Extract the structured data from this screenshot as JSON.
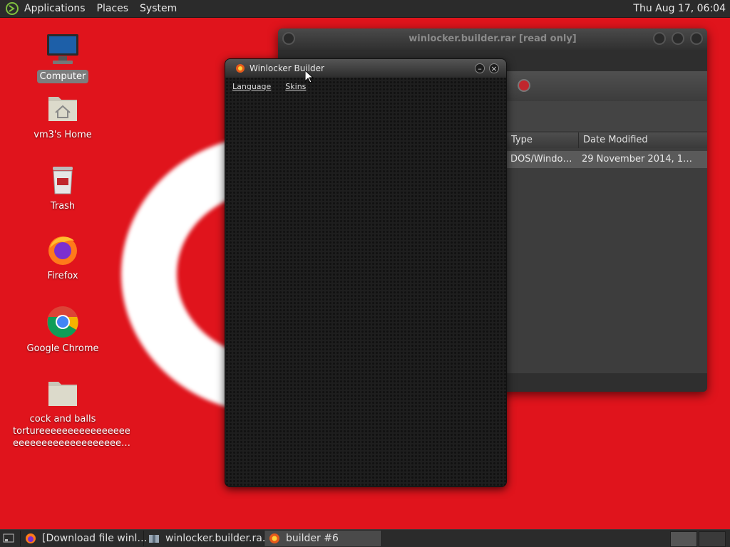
{
  "top_panel": {
    "menus": [
      "Applications",
      "Places",
      "System"
    ],
    "clock": "Thu Aug 17, 06:04"
  },
  "desktop": {
    "icons": [
      {
        "label": "Computer",
        "icon": "computer-icon"
      },
      {
        "label": "vm3's Home",
        "icon": "home-folder-icon"
      },
      {
        "label": "Trash",
        "icon": "trash-icon"
      },
      {
        "label": "Firefox",
        "icon": "firefox-icon"
      },
      {
        "label": "Google Chrome",
        "icon": "chrome-icon"
      },
      {
        "label": "cock and balls tortureeeeeeeeeeeeeeeeeeeeeeeeeeeeeeeeeeeeeeeeeeeeeeeeeeeeeeeeeeeeeeeee…",
        "line2": "tortureeeeeeeeeeeeeeee",
        "line3": "eeeeeeeeeeeeeeeeeee…",
        "line1": "cock and balls",
        "icon": "folder-icon"
      }
    ]
  },
  "archive_window": {
    "title": "winlocker.builder.rar [read only]",
    "columns": [
      "Type",
      "Date Modified"
    ],
    "row": {
      "type": "DOS/Windo…",
      "date": "29 November 2014, 1…"
    }
  },
  "builder_window": {
    "title": "Winlocker Builder",
    "menus": [
      "Language",
      "Skins"
    ]
  },
  "taskbar": {
    "tasks": [
      {
        "label": "[Download file winl…",
        "icon": "firefox-icon"
      },
      {
        "label": "winlocker.builder.ra…",
        "icon": "archive-manager-icon"
      },
      {
        "label": "builder #6",
        "icon": "builder-app-icon"
      }
    ]
  },
  "colors": {
    "wallpaper": "#e0141c",
    "panel": "#2b2b2b"
  }
}
